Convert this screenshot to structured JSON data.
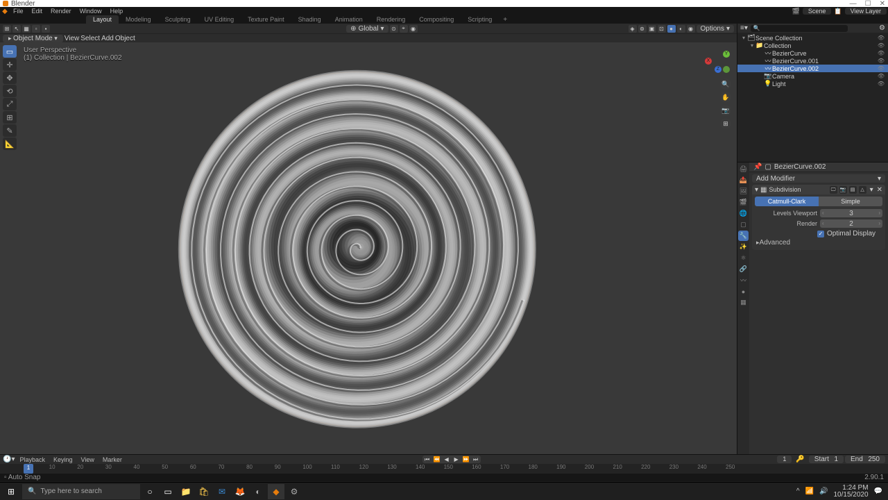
{
  "app": {
    "title": "Blender"
  },
  "window_controls": {
    "min": "—",
    "max": "☐",
    "close": "✕"
  },
  "menubar": {
    "items": [
      "File",
      "Edit",
      "Render",
      "Window",
      "Help"
    ]
  },
  "top_right": {
    "scene": "Scene",
    "view_layer": "View Layer"
  },
  "workspaces": {
    "tabs": [
      "Layout",
      "Modeling",
      "Sculpting",
      "UV Editing",
      "Texture Paint",
      "Shading",
      "Animation",
      "Rendering",
      "Compositing",
      "Scripting"
    ],
    "active": 0
  },
  "viewport_header": {
    "mode": "Object Mode",
    "menus": [
      "View",
      "Select",
      "Add",
      "Object"
    ],
    "orientation": "Global",
    "options_label": "Options"
  },
  "viewport_info": {
    "line1": "User Perspective",
    "line2": "(1) Collection | BezierCurve.002"
  },
  "outliner": {
    "search_placeholder": "",
    "tree": [
      {
        "depth": 0,
        "icon": "▾",
        "type": "scene",
        "label": "Scene Collection",
        "eye": true
      },
      {
        "depth": 1,
        "icon": "▾",
        "type": "collection",
        "label": "Collection",
        "eye": true
      },
      {
        "depth": 2,
        "icon": "",
        "type": "curve",
        "label": "BezierCurve",
        "eye": true
      },
      {
        "depth": 2,
        "icon": "",
        "type": "curve",
        "label": "BezierCurve.001",
        "eye": true
      },
      {
        "depth": 2,
        "icon": "",
        "type": "curve",
        "label": "BezierCurve.002",
        "eye": true,
        "selected": true
      },
      {
        "depth": 2,
        "icon": "",
        "type": "camera",
        "label": "Camera",
        "eye": true
      },
      {
        "depth": 2,
        "icon": "",
        "type": "light",
        "label": "Light",
        "eye": true
      }
    ]
  },
  "properties": {
    "object_name": "BezierCurve.002",
    "add_modifier_label": "Add Modifier",
    "modifier": {
      "name": "Subdivision",
      "type_options": [
        "Catmull-Clark",
        "Simple"
      ],
      "type_active": 0,
      "levels_viewport_label": "Levels Viewport",
      "levels_viewport": 3,
      "render_label": "Render",
      "render": 2,
      "optimal_display_label": "Optimal Display",
      "optimal_display": true,
      "advanced_label": "Advanced"
    }
  },
  "timeline": {
    "menus": [
      "Playback",
      "Keying",
      "View",
      "Marker"
    ],
    "current_frame": 1,
    "start_label": "Start",
    "start": 1,
    "end_label": "End",
    "end": 250,
    "ticks": [
      10,
      20,
      30,
      40,
      50,
      60,
      70,
      80,
      90,
      100,
      110,
      120,
      130,
      140,
      150,
      160,
      170,
      180,
      190,
      200,
      210,
      220,
      230,
      240,
      250
    ]
  },
  "statusbar": {
    "left": "Auto Snap",
    "version": "2.90.1"
  },
  "taskbar": {
    "search_placeholder": "Type here to search",
    "time": "1:24 PM",
    "date": "10/15/2020"
  }
}
